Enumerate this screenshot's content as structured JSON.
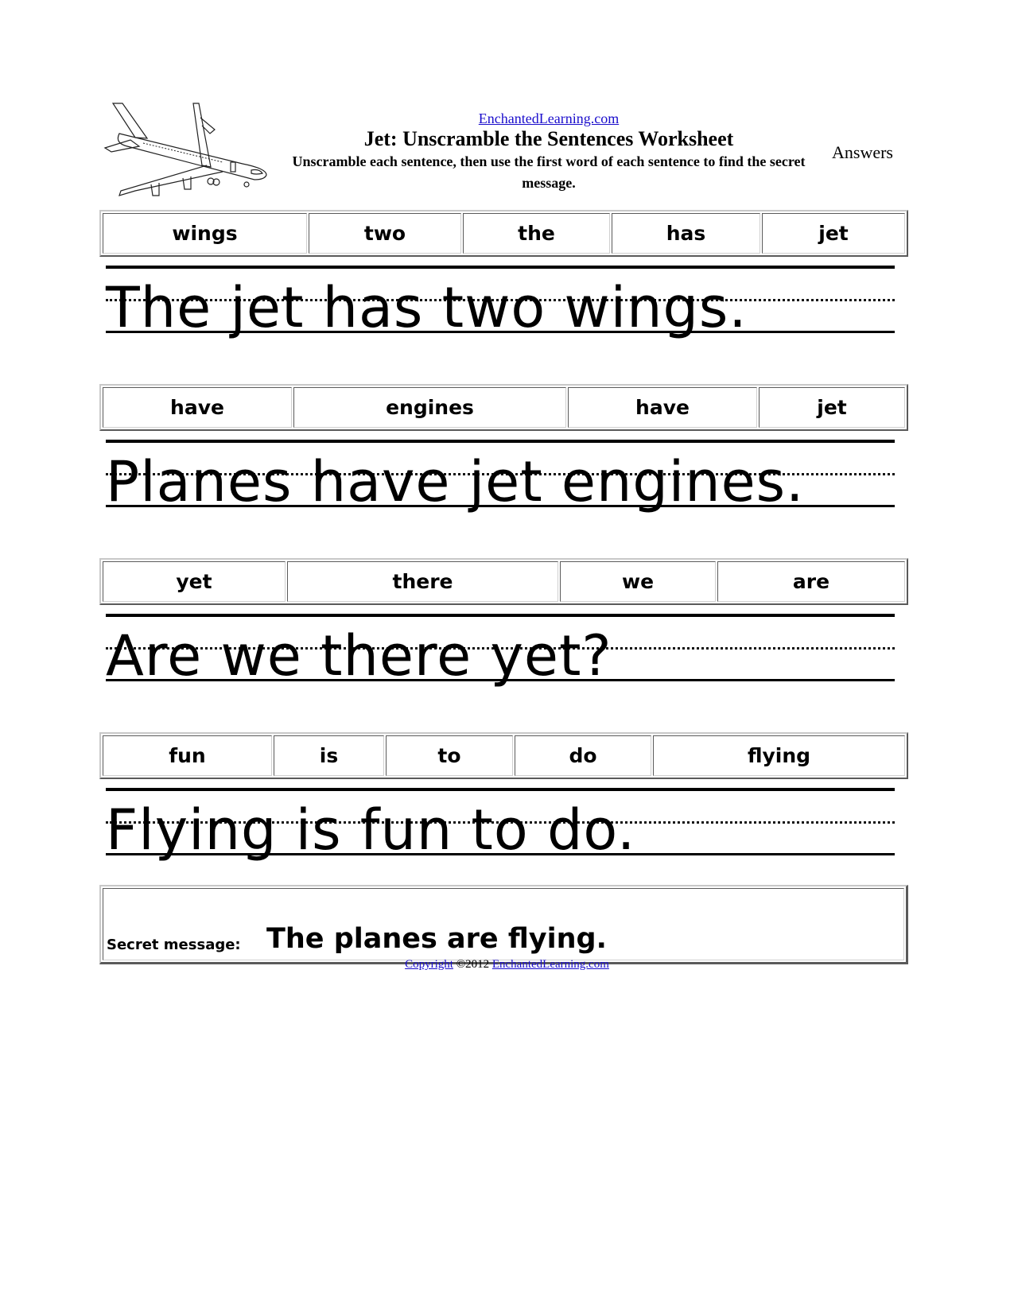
{
  "header": {
    "site_link": "EnchantedLearning.com",
    "title": "Jet: Unscramble the Sentences Worksheet",
    "instructions": "Unscramble each sentence, then use the first word of each sentence to find the secret message.",
    "answers_label": "Answers",
    "illustration": "jet-airplane-icon"
  },
  "exercises": [
    {
      "words": [
        "wings",
        "two",
        "the",
        "has",
        "jet"
      ],
      "answer": "The jet has two wings."
    },
    {
      "words": [
        "have",
        "engines",
        "have",
        "jet"
      ],
      "answer": "Planes have jet engines."
    },
    {
      "words": [
        "yet",
        "there",
        "we",
        "are"
      ],
      "answer": "Are we there yet?"
    },
    {
      "words": [
        "fun",
        "is",
        "to",
        "do",
        "flying"
      ],
      "answer": "Flying is fun to do."
    }
  ],
  "secret": {
    "label": "Secret message:",
    "answer": "The planes are flying."
  },
  "footer": {
    "copyright_link": "Copyright",
    "year_text": "©2012",
    "site_link": "EnchantedLearning.com"
  },
  "colors": {
    "link": "#1a0dcc",
    "text": "#000000",
    "border_light": "#c8c8c8",
    "border_dark": "#5a5a5a"
  }
}
